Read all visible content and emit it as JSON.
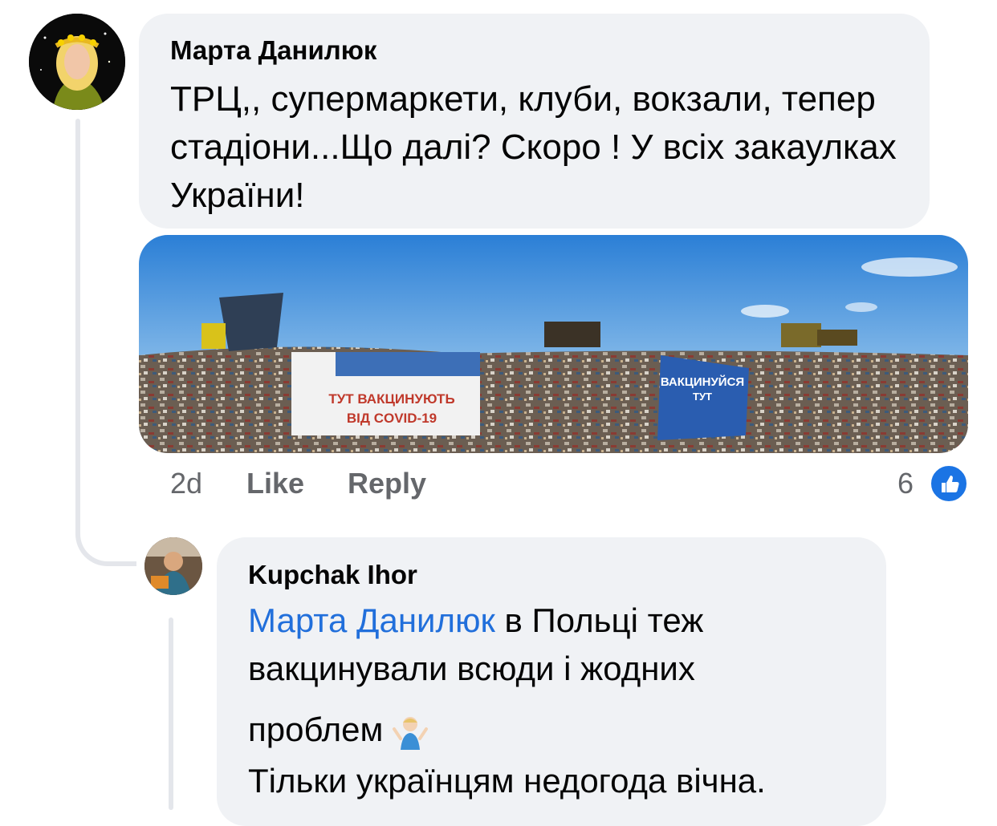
{
  "comment": {
    "author": "Марта Данилюк",
    "text": "ТРЦ,, супермаркети, клуби, вокзали, тепер стадіони...Що далі? Скоро ! У всіх закаулках України!",
    "image": {
      "sign_left": [
        "ТУТ ВАКЦИНУЮТЬ",
        "ВІД COVID-19"
      ],
      "sign_right": [
        "ВАКЦИНУЙСЯ",
        "ТУТ"
      ]
    },
    "time": "2d",
    "like_label": "Like",
    "reply_label": "Reply",
    "reaction_count": "6",
    "reaction_icon": "thumbs-up-icon",
    "accent_color": "#1b74e4"
  },
  "reply": {
    "author": "Kupchak Ihor",
    "mention": "Марта Данилюк",
    "line1": " в Польці теж",
    "line2": "вакцинували всюди і жодних",
    "line3": "проблем",
    "line4": "Тільки українцям недогода вічна.",
    "emoji": "person-shrugging-icon",
    "mention_color": "#216fdb"
  }
}
